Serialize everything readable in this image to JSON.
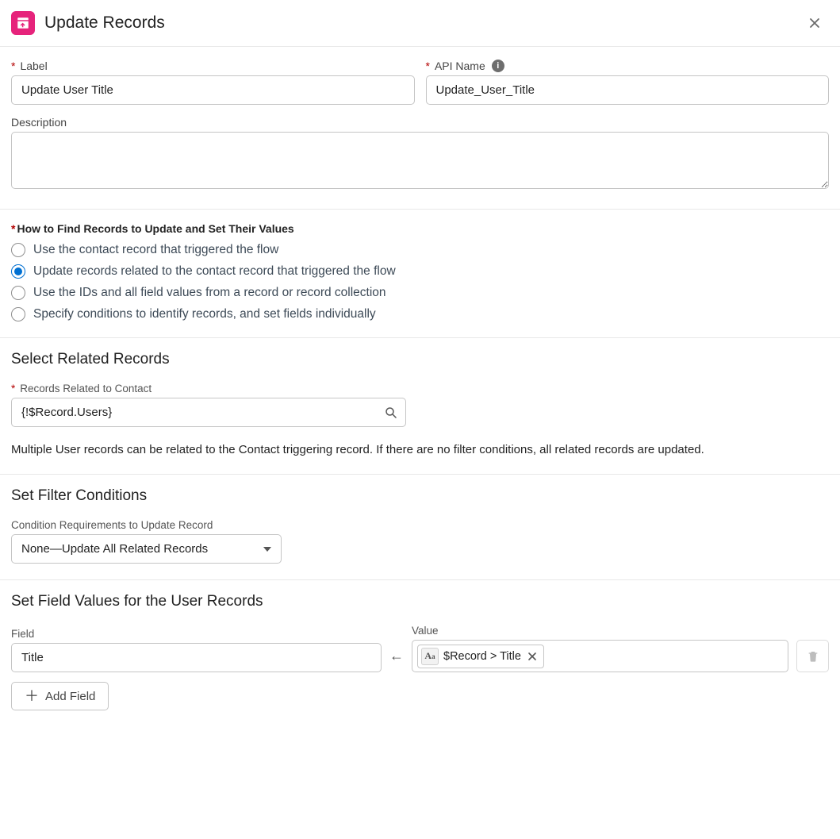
{
  "header": {
    "title": "Update Records"
  },
  "basic": {
    "label_label": "Label",
    "label_value": "Update User Title",
    "api_label": "API Name",
    "api_value": "Update_User_Title",
    "description_label": "Description",
    "description_value": ""
  },
  "howFind": {
    "title": "How to Find Records to Update and Set Their Values",
    "options": [
      "Use the contact record that triggered the flow",
      "Update records related to the contact record that triggered the flow",
      "Use the IDs and all field values from a record or record collection",
      "Specify conditions to identify records, and set fields individually"
    ],
    "selected_index": 1
  },
  "related": {
    "title": "Select Related Records",
    "lookup_label": "Records Related to Contact",
    "lookup_value": "{!$Record.Users}",
    "help_text": "Multiple User records can be related to the Contact triggering record. If there are no filter conditions, all related records are updated."
  },
  "filter": {
    "title": "Set Filter Conditions",
    "select_label": "Condition Requirements to Update Record",
    "select_value": "None—Update All Related Records"
  },
  "setValues": {
    "title": "Set Field Values for the User Records",
    "field_label": "Field",
    "field_value": "Title",
    "value_label": "Value",
    "pill_text": "$Record > Title",
    "add_button": "Add Field"
  }
}
